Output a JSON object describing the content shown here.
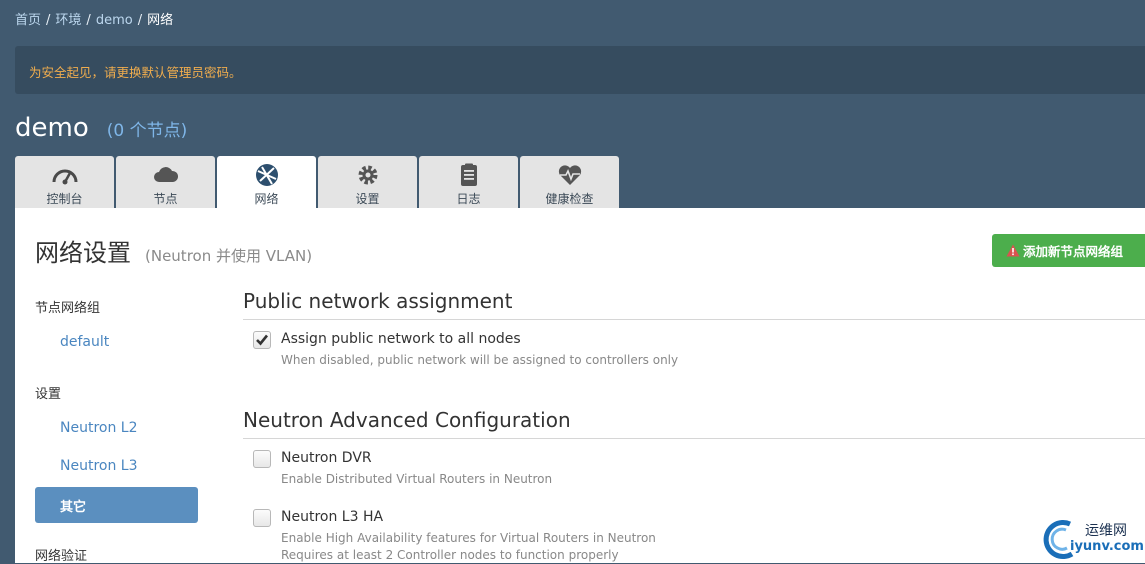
{
  "breadcrumb": {
    "home": "首页",
    "env": "环境",
    "project": "demo",
    "current": "网络",
    "separator": "/"
  },
  "alert": {
    "text": "为安全起见，请更换默认管理员密码。",
    "color": "#f0ad4e"
  },
  "env": {
    "name": "demo",
    "nodes": "(0 个节点)"
  },
  "tabs": [
    {
      "label": "控制台",
      "icon": "dashboard-gauge-icon"
    },
    {
      "label": "节点",
      "icon": "cloud-icon"
    },
    {
      "label": "网络",
      "icon": "globe-network-icon",
      "active": true
    },
    {
      "label": "设置",
      "icon": "gear-icon"
    },
    {
      "label": "日志",
      "icon": "clipboard-log-icon"
    },
    {
      "label": "健康检查",
      "icon": "heartbeat-icon"
    }
  ],
  "page": {
    "title": "网络设置",
    "subtitle": "(Neutron 并使用 VLAN)"
  },
  "add_button": {
    "label": "添加新节点网络组",
    "icon": "warning-icon",
    "color": "#4cae4c"
  },
  "sidebar": {
    "group_heading": "节点网络组",
    "group_item": "default",
    "settings_heading": "设置",
    "items": [
      "Neutron L2",
      "Neutron L3",
      "其它"
    ],
    "active_item": "其它",
    "verify_heading": "网络验证"
  },
  "sections": {
    "public": {
      "title": "Public network assignment",
      "option": {
        "label": "Assign public network to all nodes",
        "desc": "When disabled, public network will be assigned to controllers only",
        "checked": true
      }
    },
    "neutron": {
      "title": "Neutron Advanced Configuration",
      "dvr": {
        "label": "Neutron DVR",
        "desc": "Enable Distributed Virtual Routers in Neutron",
        "checked": false
      },
      "l3ha": {
        "label": "Neutron L3 HA",
        "desc1": "Enable High Availability features for Virtual Routers in Neutron",
        "desc2": "Requires at least 2 Controller nodes to function properly",
        "checked": false
      }
    }
  },
  "watermark": {
    "line1": "运维网",
    "line2": "iyunv.com"
  }
}
